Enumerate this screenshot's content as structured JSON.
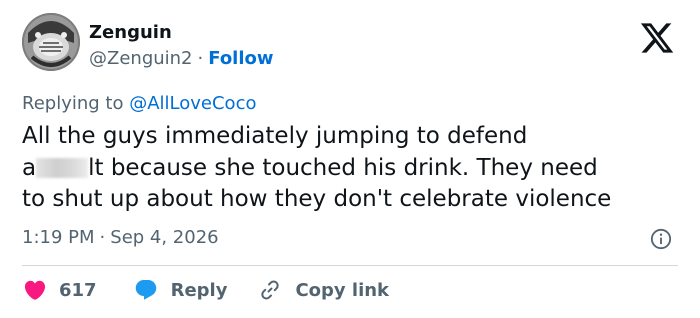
{
  "author": {
    "name": "Zenguin",
    "handle": "@Zenguin2",
    "separator": "·",
    "follow_label": "Follow"
  },
  "reply_context": {
    "prefix": "Replying to",
    "mention": "@AllLoveCoco"
  },
  "tweet": {
    "line1": "All the guys immediately jumping to defend",
    "line2_start": "a",
    "line2_end": "lt because she touched his drink. They need",
    "line3": "to shut up about how they don't celebrate violence"
  },
  "meta": {
    "time": "1:19 PM",
    "separator": "·",
    "date": "Sep 4, 2026"
  },
  "actions": {
    "like_count": "617",
    "reply_label": "Reply",
    "copy_link_label": "Copy link"
  },
  "icons": {
    "brand": "x-logo-icon",
    "info": "info-icon",
    "like": "heart-icon",
    "reply": "speech-bubble-icon",
    "copy": "link-icon"
  },
  "colors": {
    "text": "#0f1419",
    "muted": "#536471",
    "link": "#006fd6",
    "like": "#f91880",
    "reply": "#1d9bf0",
    "divider": "#cfd9de"
  }
}
